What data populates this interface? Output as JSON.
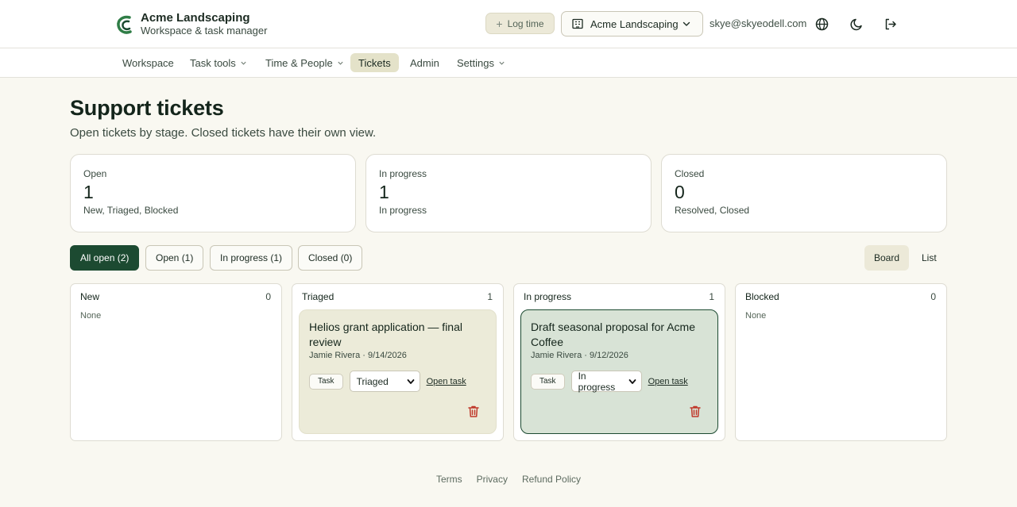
{
  "header": {
    "brand_name": "Acme Landscaping",
    "brand_sub": "Workspace & task manager",
    "log_time_label": "Log time",
    "org_name": "Acme Landscaping",
    "user_email": "skye@skyeodell.com"
  },
  "nav": {
    "items": [
      {
        "label": "Workspace"
      },
      {
        "label": "Task tools"
      },
      {
        "label": "Time & People"
      },
      {
        "label": "Tickets"
      },
      {
        "label": "Admin"
      },
      {
        "label": "Settings"
      }
    ],
    "active": "Tickets"
  },
  "page": {
    "title": "Support tickets",
    "subtitle": "Open tickets by stage. Closed tickets have their own view."
  },
  "stats": [
    {
      "label": "Open",
      "value": "1",
      "desc": "New, Triaged, Blocked"
    },
    {
      "label": "In progress",
      "value": "1",
      "desc": "In progress"
    },
    {
      "label": "Closed",
      "value": "0",
      "desc": "Resolved, Closed"
    }
  ],
  "filters": [
    {
      "label": "All open (2)",
      "active": true
    },
    {
      "label": "Open (1)"
    },
    {
      "label": "In progress (1)"
    },
    {
      "label": "Closed (0)"
    }
  ],
  "views": [
    {
      "label": "Board",
      "active": true
    },
    {
      "label": "List"
    }
  ],
  "columns": [
    {
      "name": "New",
      "count": "0",
      "empty_text": "None"
    },
    {
      "name": "Triaged",
      "count": "1"
    },
    {
      "name": "In progress",
      "count": "1"
    },
    {
      "name": "Blocked",
      "count": "0",
      "empty_text": "None"
    }
  ],
  "tickets": [
    {
      "title": "Helios grant application — final review",
      "meta": "Jamie Rivera · 9/14/2026",
      "type": "Task",
      "status": "Triaged",
      "open_label": "Open task"
    },
    {
      "title": "Draft seasonal proposal for Acme Coffee",
      "meta": "Jamie Rivera · 9/12/2026",
      "type": "Task",
      "status": "In progress",
      "open_label": "Open task"
    }
  ],
  "footer": {
    "links": [
      {
        "label": "Terms"
      },
      {
        "label": "Privacy"
      },
      {
        "label": "Refund Policy"
      }
    ]
  },
  "colors": {
    "accent": "#1c4a31",
    "background": "#f9f8f1",
    "danger": "#c0392b"
  }
}
